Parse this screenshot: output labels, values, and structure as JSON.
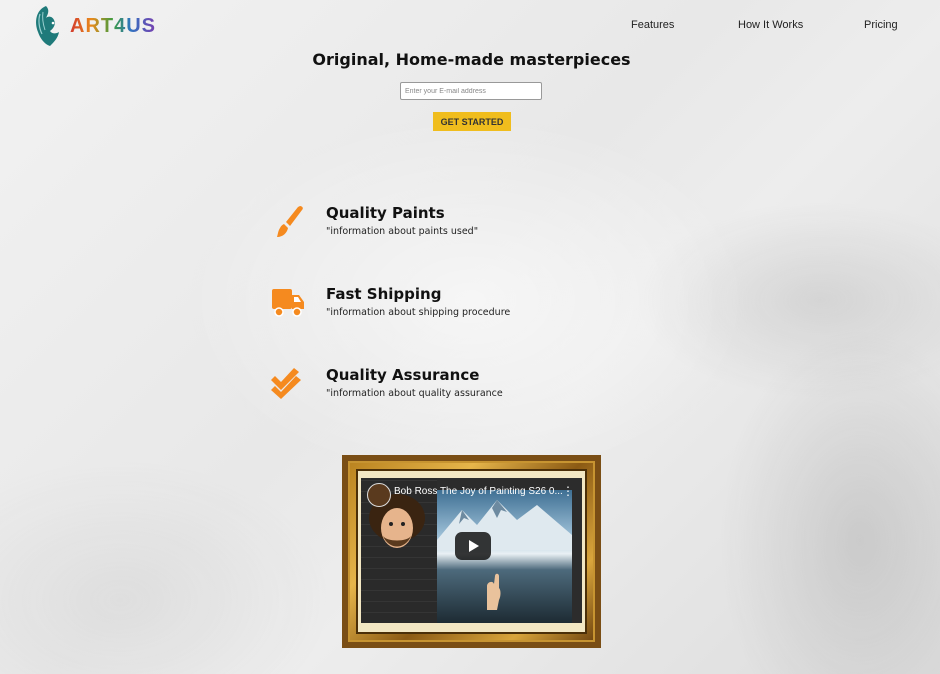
{
  "brand": {
    "name": "ART4US"
  },
  "nav": {
    "features": "Features",
    "how_it_works": "How It Works",
    "pricing": "Pricing"
  },
  "hero": {
    "title": "Original, Home-made masterpieces",
    "email_placeholder": "Enter your E-mail address",
    "cta_label": "GET STARTED"
  },
  "features": [
    {
      "icon": "paintbrush-icon",
      "title": "Quality Paints",
      "description": "\"information about paints used\""
    },
    {
      "icon": "truck-icon",
      "title": "Fast Shipping",
      "description": "\"information about shipping procedure"
    },
    {
      "icon": "check-icon",
      "title": "Quality Assurance",
      "description": "\"information about quality assurance"
    }
  ],
  "video": {
    "title": "Bob Ross The Joy of Painting S26 0...",
    "menu_icon": "more-vert-icon",
    "play_icon": "play-icon"
  },
  "colors": {
    "accent": "#f0bd1d",
    "icon_orange": "#f58a1f"
  }
}
